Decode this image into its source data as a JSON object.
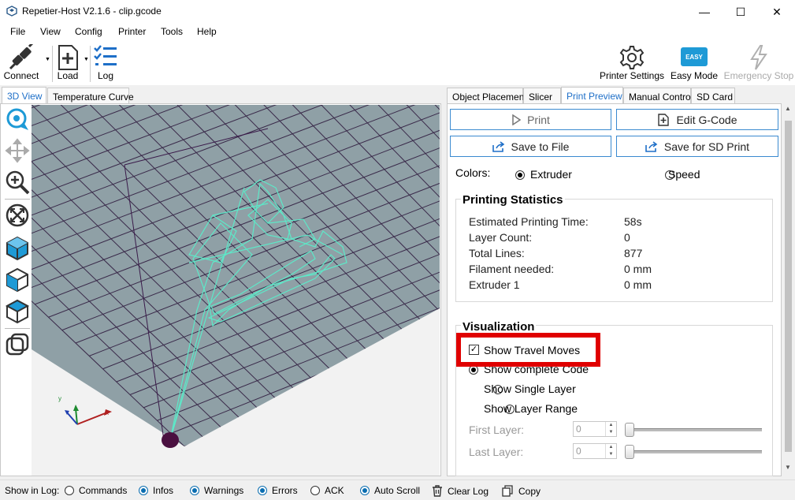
{
  "window": {
    "title": "Repetier-Host V2.1.6 - clip.gcode",
    "controls": {
      "minimize": "—",
      "maximize": "☐",
      "close": "✕"
    }
  },
  "menu": [
    "File",
    "View",
    "Config",
    "Printer",
    "Tools",
    "Help"
  ],
  "toolbar": {
    "connect": "Connect",
    "load": "Load",
    "log": "Log",
    "printer_settings": "Printer Settings",
    "easy_mode": "Easy Mode",
    "easy_badge": "EASY",
    "emergency_stop": "Emergency Stop"
  },
  "left_tabs": [
    "3D View",
    "Temperature Curve"
  ],
  "right_tabs": [
    "Object Placement",
    "Slicer",
    "Print Preview",
    "Manual Control",
    "SD Card"
  ],
  "preview": {
    "print_button": "Print",
    "edit_gcode_button": "Edit G-Code",
    "save_file_button": "Save to File",
    "save_sd_button": "Save for SD Print",
    "colors_label": "Colors:",
    "color_extruder": "Extruder",
    "color_speed": "Speed",
    "stats_title": "Printing Statistics",
    "stats": [
      {
        "label": "Estimated Printing Time:",
        "value": "58s"
      },
      {
        "label": "Layer Count:",
        "value": "0"
      },
      {
        "label": "Total Lines:",
        "value": "877"
      },
      {
        "label": "Filament needed:",
        "value": "0 mm"
      },
      {
        "label": "Extruder 1",
        "value": "0 mm"
      }
    ],
    "vis_title": "Visualization",
    "show_travel": "Show Travel Moves",
    "show_complete": "Show complete Code",
    "show_single": "Show Single Layer",
    "show_range": "Show Layer Range",
    "first_layer_label": "First Layer:",
    "first_layer_value": "0",
    "last_layer_label": "Last Layer:",
    "last_layer_value": "0"
  },
  "statusbar": {
    "show_in_log": "Show in Log:",
    "commands": "Commands",
    "infos": "Infos",
    "warnings": "Warnings",
    "errors": "Errors",
    "ack": "ACK",
    "auto_scroll": "Auto Scroll",
    "clear_log": "Clear Log",
    "copy": "Copy"
  },
  "colors": {
    "accent": "#1e6fc8",
    "bed": "#8fa0a6",
    "grid": "#3a2a4a",
    "model": "#5de8c8",
    "highlight": "#e00000",
    "nozzle": "#4a1040"
  }
}
